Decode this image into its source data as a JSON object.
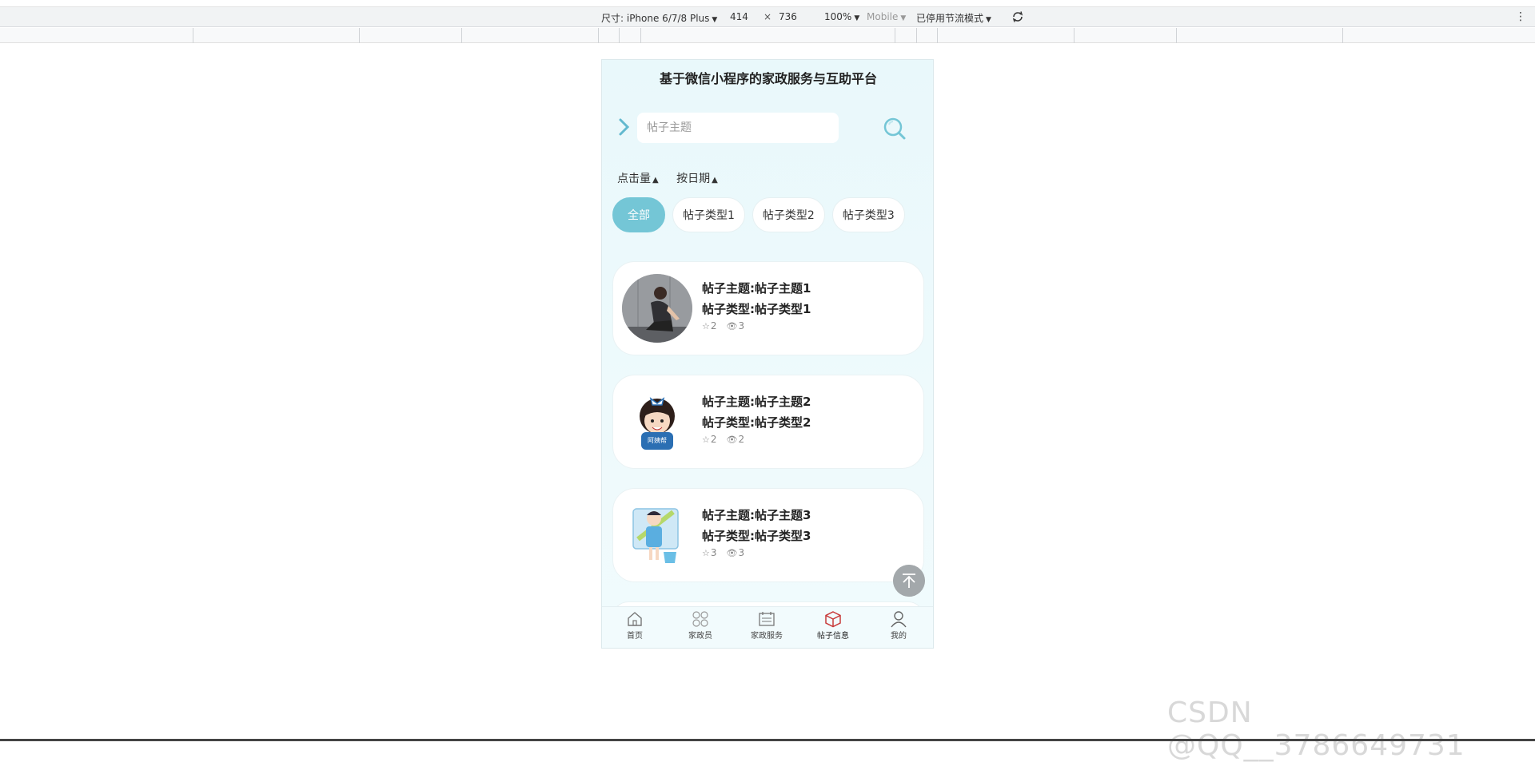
{
  "devtools": {
    "size_label": "尺寸: iPhone 6/7/8 Plus",
    "width": "414",
    "times": "×",
    "height": "736",
    "zoom": "100%",
    "mode": "Mobile",
    "throttle": "已停用节流模式",
    "more": "⋮"
  },
  "app": {
    "title": "基于微信小程序的家政服务与互助平台",
    "search": {
      "placeholder": "帖子主题"
    },
    "sort": [
      {
        "label": "点击量",
        "arrow": "▲"
      },
      {
        "label": "按日期",
        "arrow": "▲"
      }
    ],
    "categories": [
      "全部",
      "帖子类型1",
      "帖子类型2",
      "帖子类型3"
    ],
    "active_category": "全部",
    "posts": [
      {
        "topic": "帖子主题:帖子主题1",
        "type": "帖子类型:帖子类型1",
        "stars": "2",
        "views": "3"
      },
      {
        "topic": "帖子主题:帖子主题2",
        "type": "帖子类型:帖子类型2",
        "stars": "2",
        "views": "2"
      },
      {
        "topic": "帖子主题:帖子主题3",
        "type": "帖子类型:帖子类型3",
        "stars": "3",
        "views": "3"
      }
    ],
    "tabs": [
      {
        "label": "首页",
        "icon": "home-icon"
      },
      {
        "label": "家政员",
        "icon": "grid-icon"
      },
      {
        "label": "家政服务",
        "icon": "calendar-icon"
      },
      {
        "label": "帖子信息",
        "icon": "cube-icon"
      },
      {
        "label": "我的",
        "icon": "user-icon"
      }
    ],
    "active_tab": "帖子信息",
    "accent_color": "#74c6d6",
    "active_tab_color": "#c83a3a"
  },
  "watermark": "CSDN @QQ__3786649731"
}
